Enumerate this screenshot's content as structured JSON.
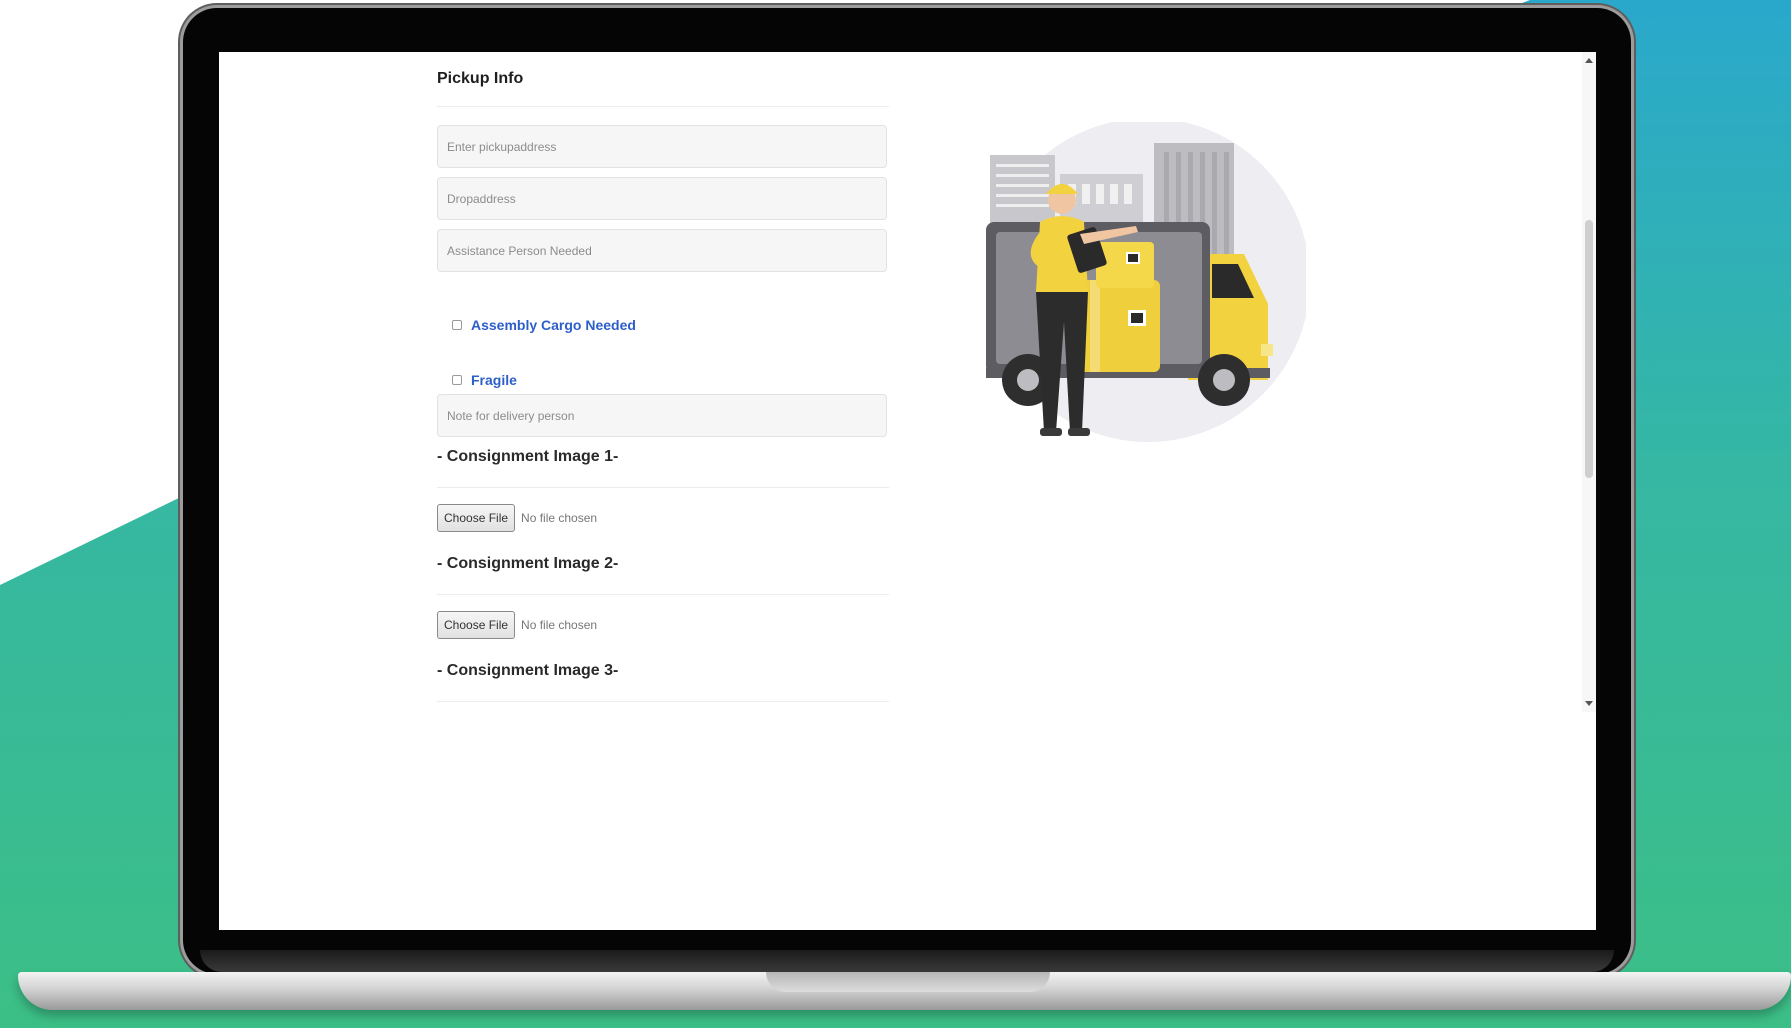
{
  "form": {
    "section_title": "Pickup Info",
    "inputs": {
      "pickup_address": {
        "placeholder": "Enter pickupaddress",
        "value": ""
      },
      "drop_address": {
        "placeholder": "Dropaddress",
        "value": ""
      },
      "assistance_person": {
        "placeholder": "Assistance Person Needed",
        "value": ""
      },
      "delivery_note": {
        "placeholder": "Note for delivery person",
        "value": ""
      }
    },
    "checkboxes": [
      {
        "label": "Assembly Cargo Needed",
        "checked": false
      },
      {
        "label": "Fragile",
        "checked": false
      }
    ],
    "consignment_images": [
      {
        "heading": "- Consignment Image 1-",
        "button_label": "Choose File",
        "status": "No file chosen"
      },
      {
        "heading": "- Consignment Image 2-",
        "button_label": "Choose File",
        "status": "No file chosen"
      },
      {
        "heading": "- Consignment Image 3-"
      }
    ]
  },
  "illustration": {
    "icon": "delivery-truck-illustration"
  },
  "colors": {
    "accent_blue": "#2d5fc9",
    "illustration_yellow": "#f2d23f",
    "background_teal": "#35b7a4"
  }
}
